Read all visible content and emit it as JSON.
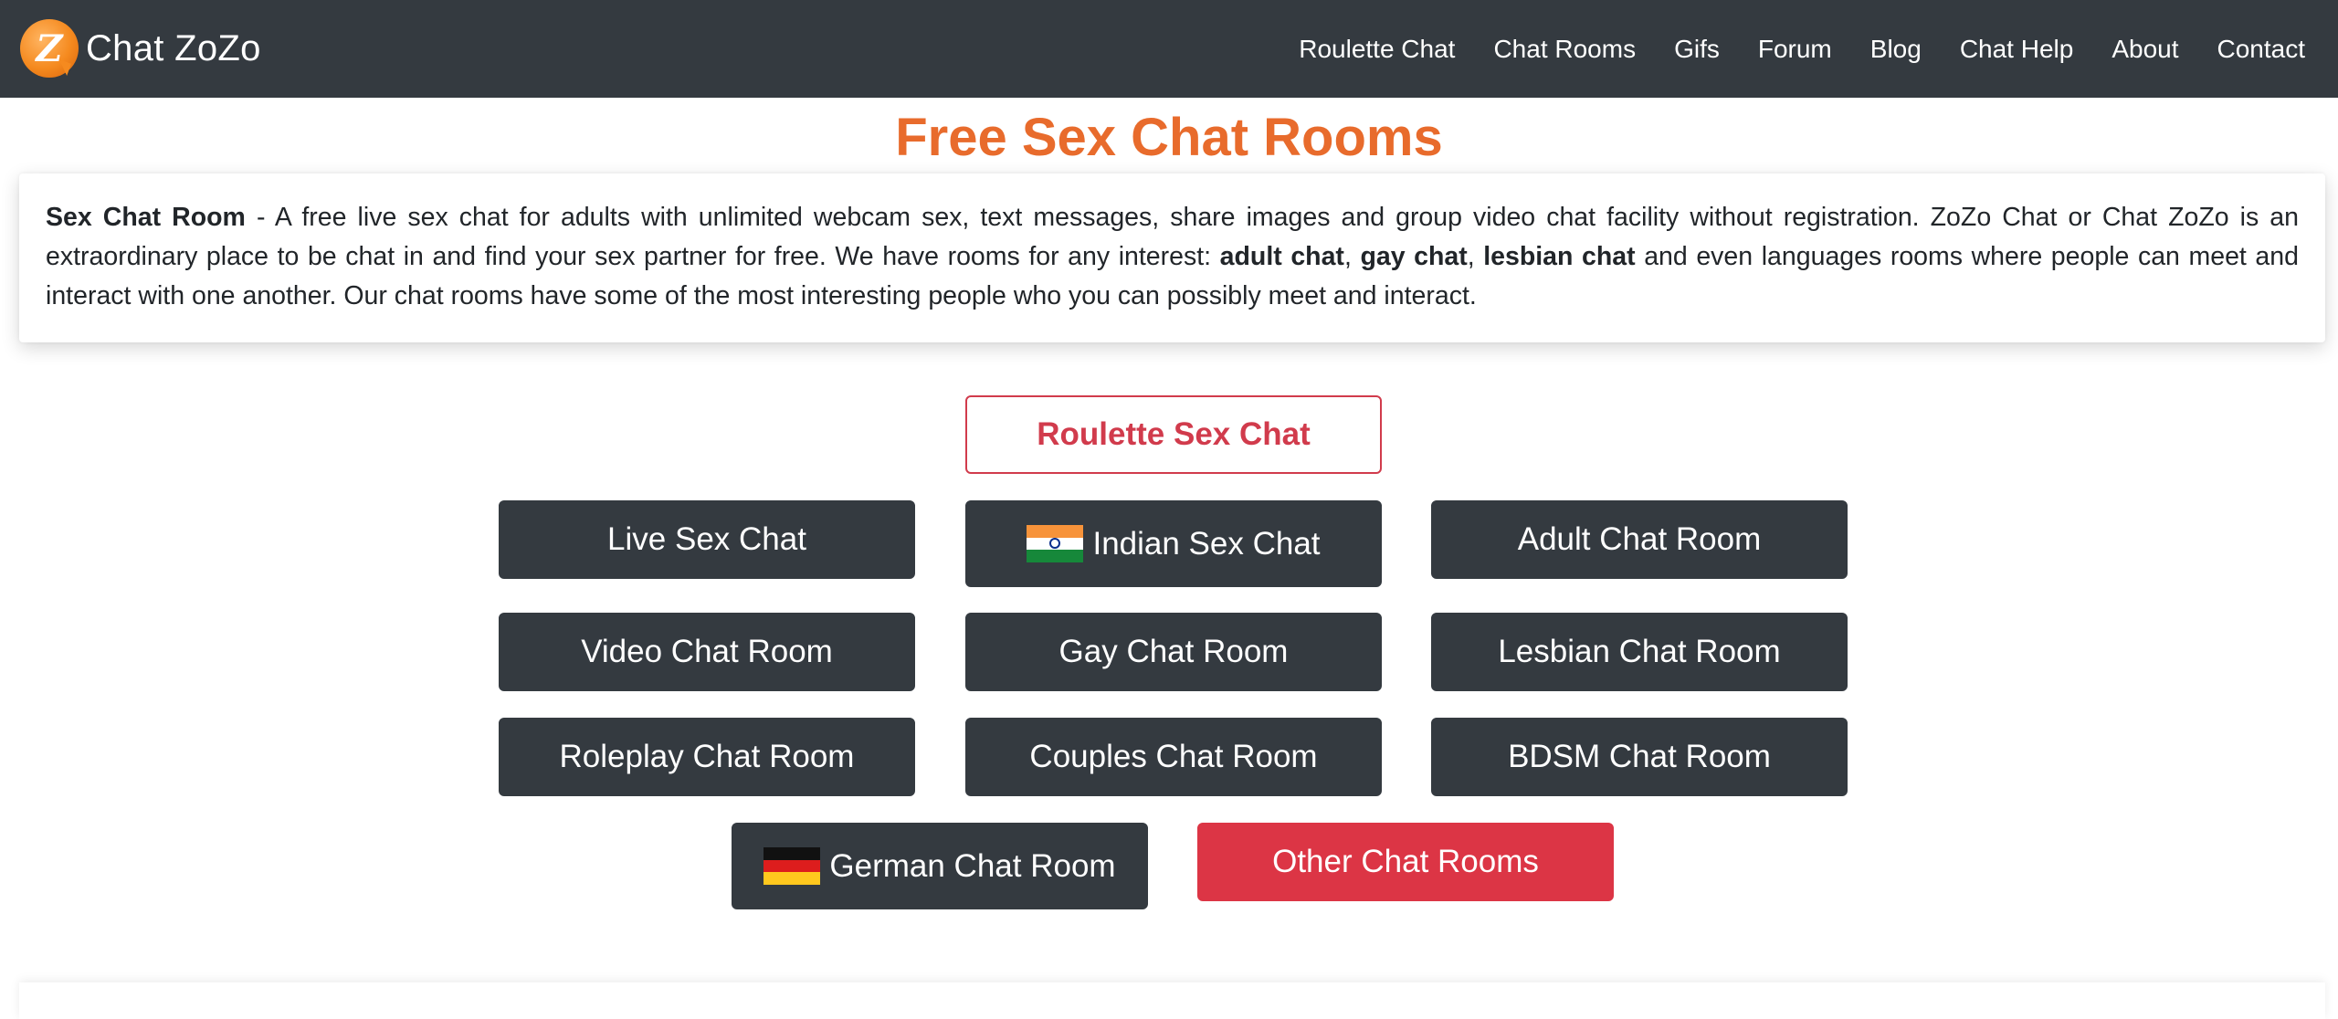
{
  "navbar": {
    "brand": "Chat ZoZo",
    "logo_letter": "Z",
    "links": [
      "Roulette Chat",
      "Chat Rooms",
      "Gifs",
      "Forum",
      "Blog",
      "Chat Help",
      "About",
      "Contact"
    ]
  },
  "page": {
    "title": "Free Sex Chat Rooms"
  },
  "intro": {
    "lead": "Sex Chat Room",
    "text_1": " - A free live sex chat for adults with unlimited webcam sex, text messages, share images and group video chat facility without registration. ZoZo Chat or Chat ZoZo is an extraordinary place to be chat in and find your sex partner for free. We have rooms for any interest: ",
    "adult": "adult chat",
    "sep_1": ", ",
    "gay": "gay chat",
    "sep_2": ", ",
    "lesbian": "lesbian chat",
    "text_2": " and even languages rooms where people can meet and interact with one another. Our chat rooms have some of the most interesting people who you can possibly meet and interact."
  },
  "buttons": {
    "roulette": "Roulette Sex Chat",
    "live": "Live Sex Chat",
    "indian": "Indian Sex Chat",
    "adult": "Adult Chat Room",
    "video": "Video Chat Room",
    "gay": "Gay Chat Room",
    "lesbian": "Lesbian Chat Room",
    "roleplay": "Roleplay Chat Room",
    "couples": "Couples Chat Room",
    "bdsm": "BDSM Chat Room",
    "german": "German Chat Room",
    "other": "Other Chat Rooms"
  },
  "colors": {
    "navbar": "#343a40",
    "title_orange": "#e86b2c",
    "button_dark": "#343a40",
    "button_red": "#dc3545",
    "outline_red": "#d13b4c"
  },
  "icons": {
    "logo": "chat-zozo-logo",
    "indian_flag": "india-flag-icon",
    "german_flag": "germany-flag-icon"
  }
}
